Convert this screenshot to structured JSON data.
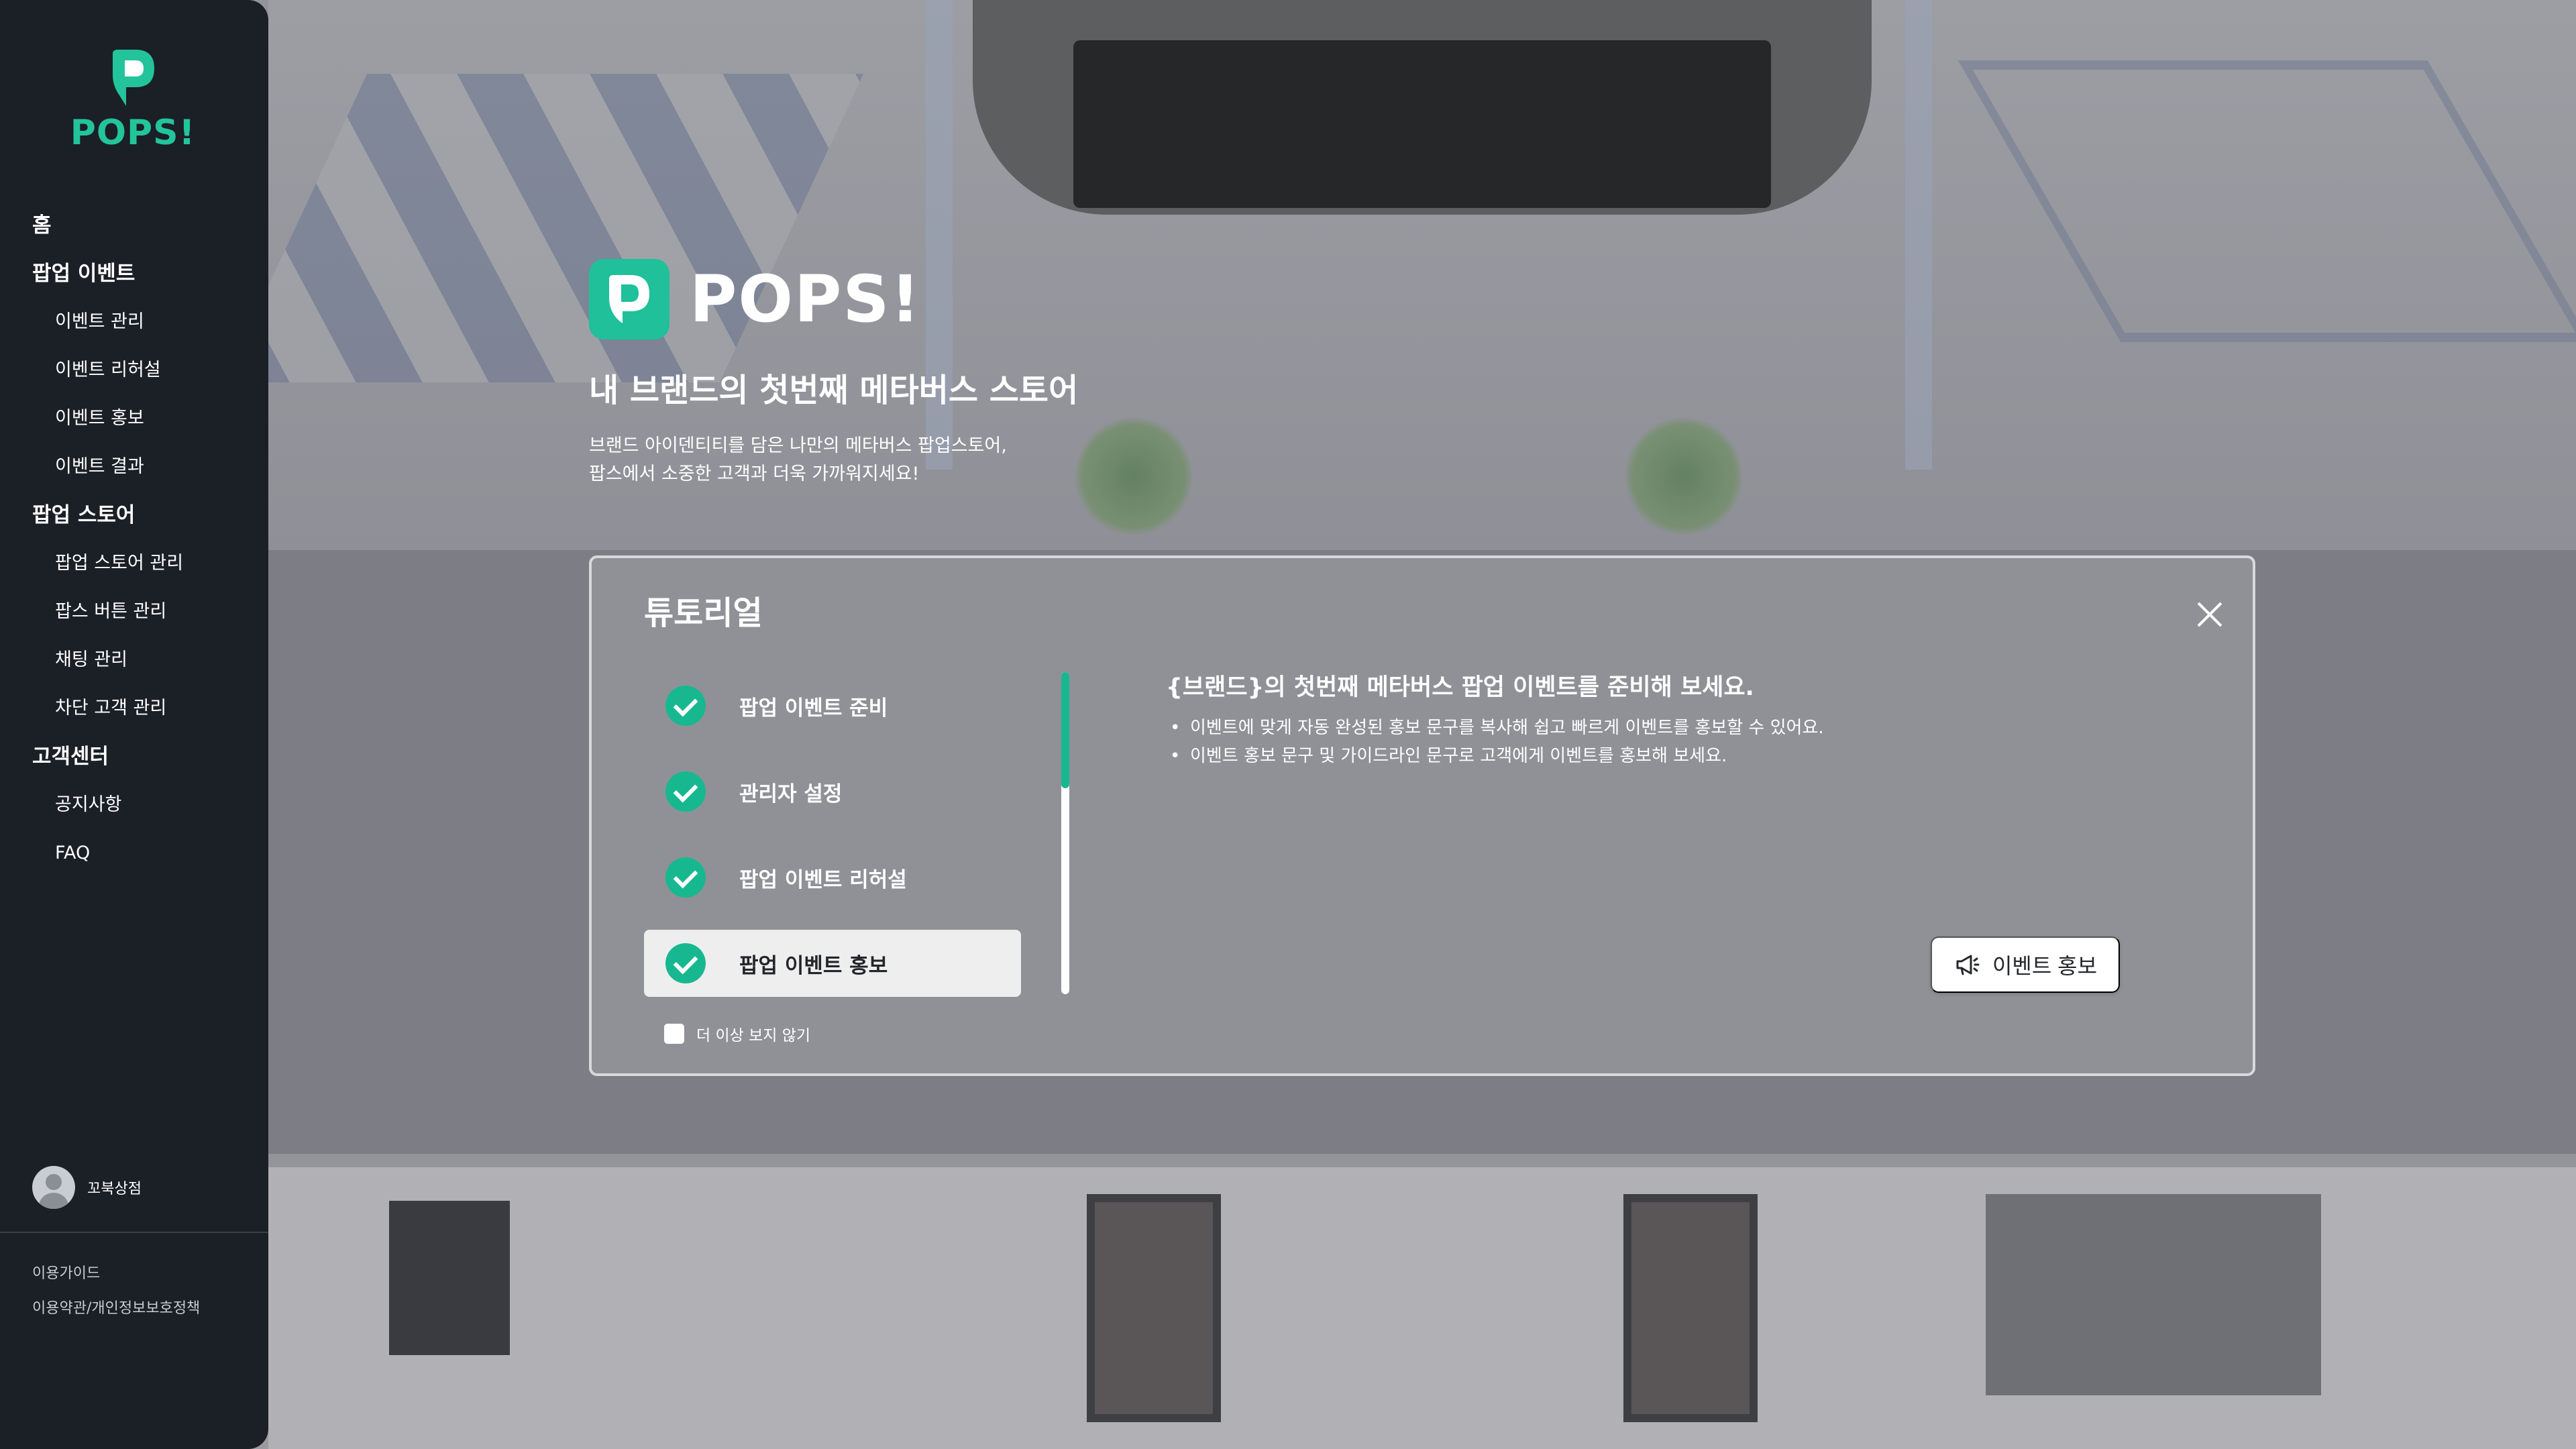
{
  "sidebar": {
    "logo_text": "POPS!",
    "nav": {
      "home": "홈",
      "popup_event": {
        "label": "팝업 이벤트",
        "items": [
          "이벤트 관리",
          "이벤트 리허설",
          "이벤트 홍보",
          "이벤트 결과"
        ]
      },
      "popup_store": {
        "label": "팝업 스토어",
        "items": [
          "팝업 스토어 관리",
          "팝스 버튼 관리",
          "채팅 관리",
          "차단 고객 관리"
        ]
      },
      "support": {
        "label": "고객센터",
        "items": [
          "공지사항",
          "FAQ"
        ]
      }
    },
    "user_name": "꼬북상점",
    "footer": {
      "guide": "이용가이드",
      "terms": "이용약관/개인정보보호정책"
    }
  },
  "hero": {
    "brand": "POPS!",
    "title": "내 브랜드의 첫번째 메타버스 스토어",
    "desc_line1": "브랜드 아이덴티티를 담은 나만의 메타버스 팝업스토어,",
    "desc_line2": "팝스에서 소중한 고객과 더욱 가까워지세요!"
  },
  "tutorial": {
    "title": "튜토리얼",
    "steps": [
      {
        "label": "팝업 이벤트 준비",
        "done": true
      },
      {
        "label": "관리자 설정",
        "done": true
      },
      {
        "label": "팝업 이벤트 리허설",
        "done": true
      },
      {
        "label": "팝업 이벤트 홍보",
        "done": true,
        "active": true
      }
    ],
    "progress": 0.36,
    "dont_show_again": "더 이상 보지 않기",
    "content_title": "{브랜드}의 첫번째 메타버스 팝업 이벤트를 준비해 보세요.",
    "bullets": [
      "이벤트에 맞게 자동 완성된 홍보 문구를 복사해 쉽고 빠르게 이벤트를 홍보할 수 있어요.",
      "이벤트 홍보 문구 및 가이드라인 문구로 고객에게 이벤트를 홍보해 보세요."
    ],
    "action_button": "이벤트 홍보",
    "action_icon": "megaphone-icon"
  },
  "colors": {
    "accent": "#1fc09a",
    "sidebar_bg": "#1b1f26"
  }
}
